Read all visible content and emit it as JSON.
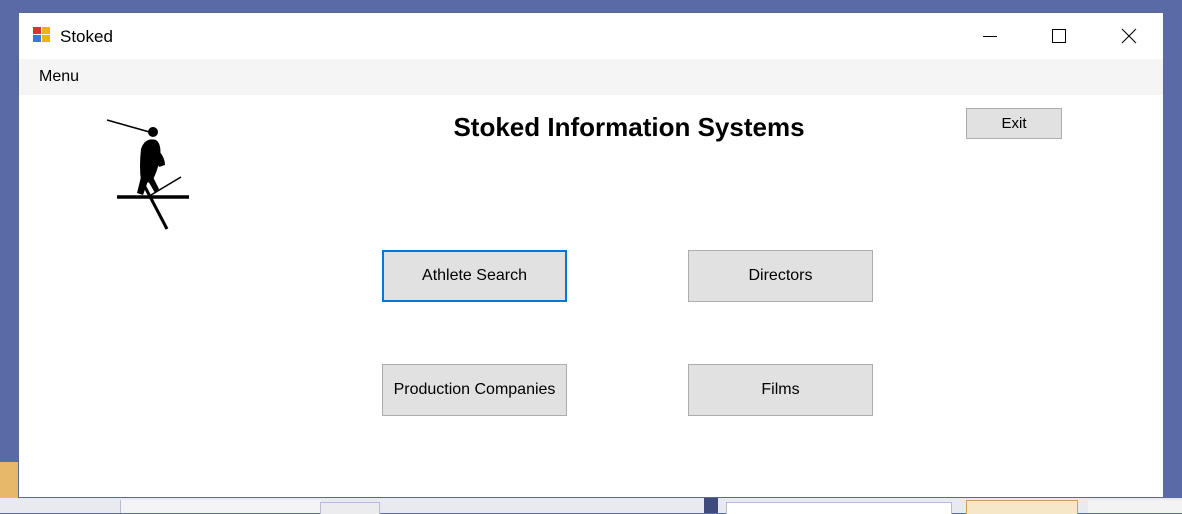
{
  "window": {
    "title": "Stoked"
  },
  "menu": {
    "items": [
      "Menu"
    ]
  },
  "main": {
    "heading": "Stoked Information Systems",
    "exit_label": "Exit",
    "buttons": {
      "athlete_search": "Athlete Search",
      "directors": "Directors",
      "production_companies": "Production Companies",
      "films": "Films"
    },
    "focused_button": "athlete_search"
  },
  "icons": {
    "app": "app-window-icon",
    "logo": "skier-silhouette-icon",
    "minimize": "minimize-icon",
    "maximize": "maximize-icon",
    "close": "close-icon"
  },
  "colors": {
    "focus": "#0078d7",
    "button_face": "#e1e1e1",
    "button_border": "#adadad",
    "menubar": "#f5f5f5"
  }
}
